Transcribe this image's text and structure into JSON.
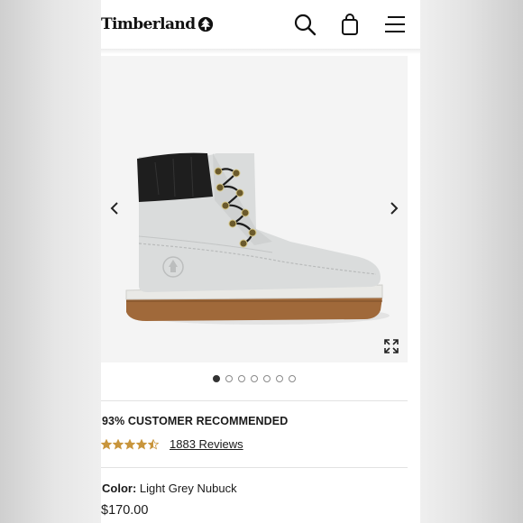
{
  "header": {
    "brand": "Timberland",
    "icons": [
      "search-icon",
      "shopping-bag-icon",
      "menu-icon"
    ]
  },
  "gallery": {
    "image": "Light grey nubuck boot with black padded collar and gum sole",
    "total_images": 7,
    "active_index": 0,
    "controls": [
      "previous-arrow-icon",
      "next-arrow-icon",
      "expand-icon"
    ]
  },
  "product": {
    "recommendation": "93% CUSTOMER RECOMMENDED",
    "rating": 4.5,
    "reviews_text": "1883 Reviews",
    "color_label": "Color:",
    "color_value": "Light Grey Nubuck",
    "price": "$170.00"
  },
  "colors": {
    "star": "#c8953c",
    "page": "#ffffff",
    "divider": "#e2e2e2"
  }
}
